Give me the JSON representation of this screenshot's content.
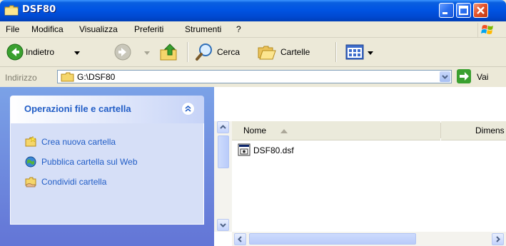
{
  "window": {
    "title": "DSF80",
    "title_icon": "folder-icon",
    "controls": {
      "minimize_icon": "minimize-icon",
      "maximize_icon": "maximize-icon",
      "close_icon": "close-icon"
    },
    "colors": {
      "titlebar": "#0054e3",
      "close": "#e4532b",
      "task_link": "#215dc6",
      "task_pane": "#7ba2e7"
    }
  },
  "menubar": {
    "items": [
      "File",
      "Modifica",
      "Visualizza",
      "Preferiti",
      "Strumenti",
      "?"
    ],
    "logo_icon": "windows-logo-icon"
  },
  "toolbar": {
    "back_label": "Indietro",
    "back_icon": "back-arrow-icon",
    "forward_icon": "forward-arrow-icon",
    "up_icon": "folder-up-icon",
    "search_label": "Cerca",
    "search_icon": "search-icon",
    "folders_label": "Cartelle",
    "folders_icon": "folders-icon",
    "views_icon": "views-icon"
  },
  "address": {
    "label": "Indirizzo",
    "path": "G:\\DSF80",
    "go_label": "Vai",
    "go_icon": "go-arrow-icon"
  },
  "taskpane": {
    "title": "Operazioni file e cartella",
    "collapse_icon": "collapse-chevron-icon",
    "tasks": [
      {
        "label": "Crea nuova cartella",
        "icon": "new-folder-icon"
      },
      {
        "label": "Pubblica cartella sul Web",
        "icon": "publish-web-icon"
      },
      {
        "label": "Condividi cartella",
        "icon": "share-folder-icon"
      }
    ]
  },
  "filelist": {
    "columns": [
      "Nome",
      "Dimens"
    ],
    "sort_icon": "sort-ascending-icon",
    "files": [
      {
        "name": "DSF80.dsf",
        "icon": "dsf-file-icon"
      }
    ]
  }
}
